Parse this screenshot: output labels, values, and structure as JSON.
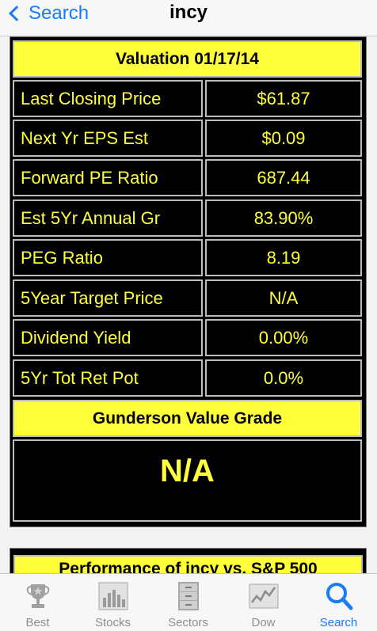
{
  "nav": {
    "back_label": "Search",
    "title": "incy"
  },
  "valuation": {
    "header": "Valuation 01/17/14",
    "rows": [
      {
        "label": "Last Closing Price",
        "value": "$61.87"
      },
      {
        "label": "Next Yr EPS Est",
        "value": "$0.09"
      },
      {
        "label": "Forward PE Ratio",
        "value": "687.44"
      },
      {
        "label": "Est 5Yr Annual Gr",
        "value": "83.90%"
      },
      {
        "label": "PEG Ratio",
        "value": "8.19"
      },
      {
        "label": "5Year Target Price",
        "value": "N/A"
      },
      {
        "label": "Dividend Yield",
        "value": "0.00%"
      },
      {
        "label": "5Yr Tot Ret Pot",
        "value": "0.0%"
      }
    ],
    "grade_header": "Gunderson Value Grade",
    "grade": "N/A"
  },
  "performance": {
    "header": "Performance of incy  vs.  S&P 500"
  },
  "tabs": [
    {
      "label": "Best",
      "icon": "trophy-icon",
      "active": false
    },
    {
      "label": "Stocks",
      "icon": "bar-chart-icon",
      "active": false
    },
    {
      "label": "Sectors",
      "icon": "file-cabinet-icon",
      "active": false
    },
    {
      "label": "Dow",
      "icon": "line-chart-icon",
      "active": false
    },
    {
      "label": "Search",
      "icon": "search-icon",
      "active": true
    }
  ],
  "colors": {
    "accent": "#1a7cf5",
    "highlight": "#ffff3b",
    "panel": "#000000"
  }
}
